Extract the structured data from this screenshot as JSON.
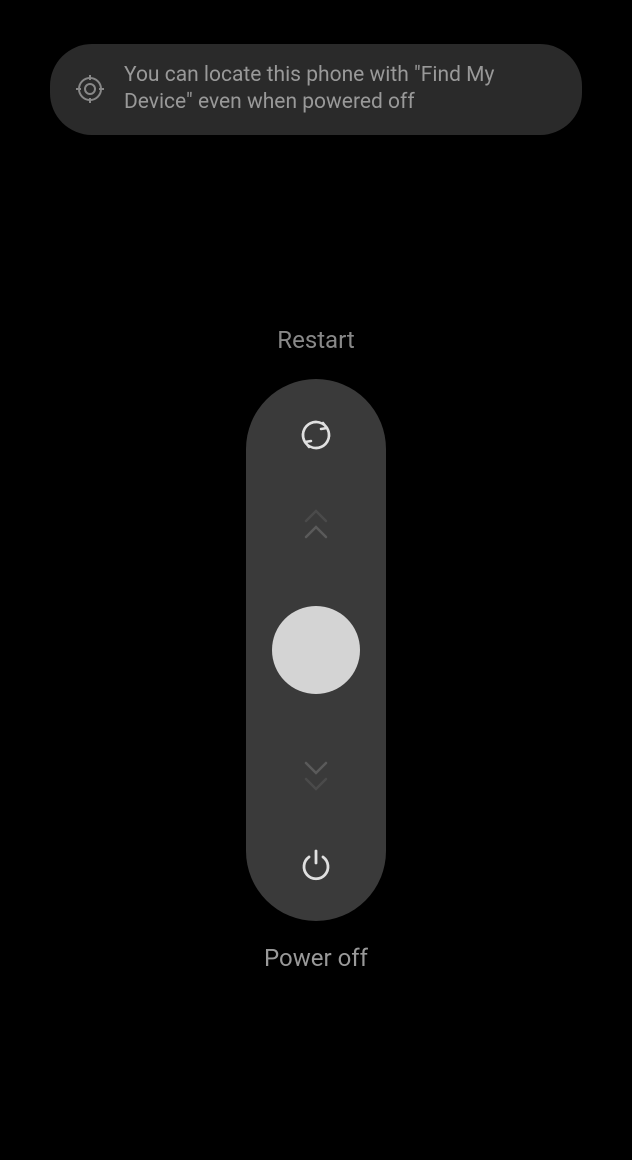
{
  "notification": {
    "text": "You can locate this phone with \"Find My Device\" even when powered off"
  },
  "slider": {
    "top_label": "Restart",
    "bottom_label": "Power off"
  }
}
